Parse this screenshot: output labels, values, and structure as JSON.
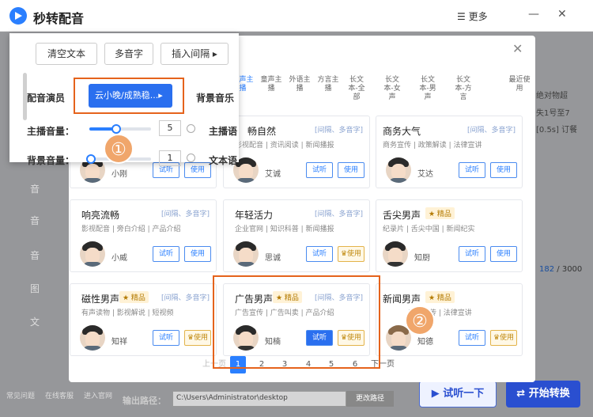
{
  "app": {
    "title": "秒转配音",
    "more": "更多"
  },
  "left_nav": [
    "音",
    "音",
    "音",
    "图",
    "文"
  ],
  "bg_right": {
    "line1": "绝对物超",
    "line2": "失1号至7",
    "line3": "[0.5s] 订餐"
  },
  "counter": {
    "current": "182",
    "total": "/ 3000"
  },
  "footer": {
    "items": [
      "常见问题",
      "在线客服",
      "进入官网"
    ],
    "path_label": "输出路径：",
    "path_value": "C:\\Users\\Administrator\\desktop",
    "change_dir": "更改路径",
    "listen": "试听一下",
    "convert": "开始转换"
  },
  "modal": {
    "tabs": [
      "男声主播",
      "童声主播",
      "外语主播",
      "方言主播",
      "长文本-全部",
      "长文本-女声",
      "长文本-男声",
      "长文本-方言",
      "最近使用"
    ],
    "voices": [
      {
        "title": "畅自然",
        "tags": "影视配音 | 资讯阅读 | 新闻播报",
        "note": "[间隔、多音字]",
        "name": "小刚",
        "premium": false
      },
      {
        "title": "",
        "tags": "",
        "note": "[间隔、多音字]",
        "name": "艾诚",
        "premium": false
      },
      {
        "title": "商务大气",
        "tags": "商务宣传 | 政策解读 | 法律宣讲",
        "note": "[间隔、多音字]",
        "name": "艾达",
        "premium": false
      },
      {
        "title": "响亮流畅",
        "tags": "影视配音 | 旁白介绍 | 产品介绍",
        "note": "[间隔、多音字]",
        "name": "小威",
        "premium": false
      },
      {
        "title": "年轻活力",
        "tags": "企业官网 | 知识科普 | 新闻播报",
        "note": "[间隔、多音字]",
        "name": "思诚",
        "premium": true
      },
      {
        "title": "舌尖男声",
        "tags": "纪录片 | 舌尖中国 | 新闻纪实",
        "note": "",
        "name": "知厨",
        "premium": true
      },
      {
        "title": "磁性男声",
        "tags": "有声读物 | 影视解说 | 短视频",
        "note": "[间隔、多音字]",
        "name": "知祥",
        "premium": true
      },
      {
        "title": "广告男声",
        "tags": "广告宣传 | 广告叫卖 | 产品介绍",
        "note": "[间隔、多音字]",
        "name": "知楠",
        "premium": true
      },
      {
        "title": "新闻男声",
        "tags": "产品宣传 | 法律宣讲",
        "note": "",
        "name": "知德",
        "premium": true
      }
    ],
    "premium_label": "★ 精品",
    "try_label": "试听",
    "use_label": "使用",
    "pager": {
      "prev": "上一页",
      "next": "下一页",
      "pages": [
        "1",
        "2",
        "3",
        "4",
        "5",
        "6"
      ]
    }
  },
  "panel": {
    "clear": "清空文本",
    "polyphone": "多音字",
    "insert_pause": "插入间隔",
    "actor_label": "配音演员",
    "actor_value": "云小晚/成熟稳...",
    "bgm_label": "背景音乐",
    "host_vol_label": "主播音量：",
    "host_vol_value": "5",
    "bg_vol_label": "背景音量：",
    "bg_vol_value": "1",
    "host_voice": "主播语",
    "text_voice": "文本语"
  },
  "badges": [
    "①",
    "②"
  ],
  "colors": {
    "accent": "#2a7fff",
    "highlight": "#e5631c",
    "badge": "#f0a66b"
  }
}
